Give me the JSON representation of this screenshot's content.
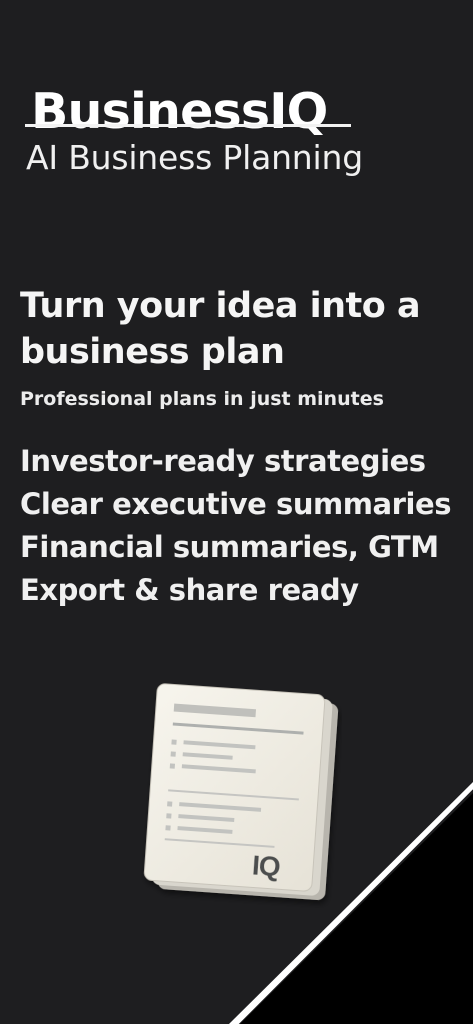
{
  "app": {
    "title": "BusinessIQ",
    "tagline": "AI Business Planning"
  },
  "hero": {
    "headline": "Turn your idea into a business plan",
    "subhead": "Professional plans in just minutes"
  },
  "features": [
    "Investor-ready strategies",
    "Clear executive summaries",
    "Financial summaries, GTM",
    "Export & share ready"
  ],
  "document": {
    "icon": "business-plan-document-icon",
    "badge": "IQ"
  },
  "colors": {
    "background": "#1e1e20",
    "text": "#f4f4f4",
    "paper": "#f1efe6",
    "paper_lines": "#b8b8b4",
    "corner": "#000000",
    "corner_edge": "#ffffff"
  }
}
